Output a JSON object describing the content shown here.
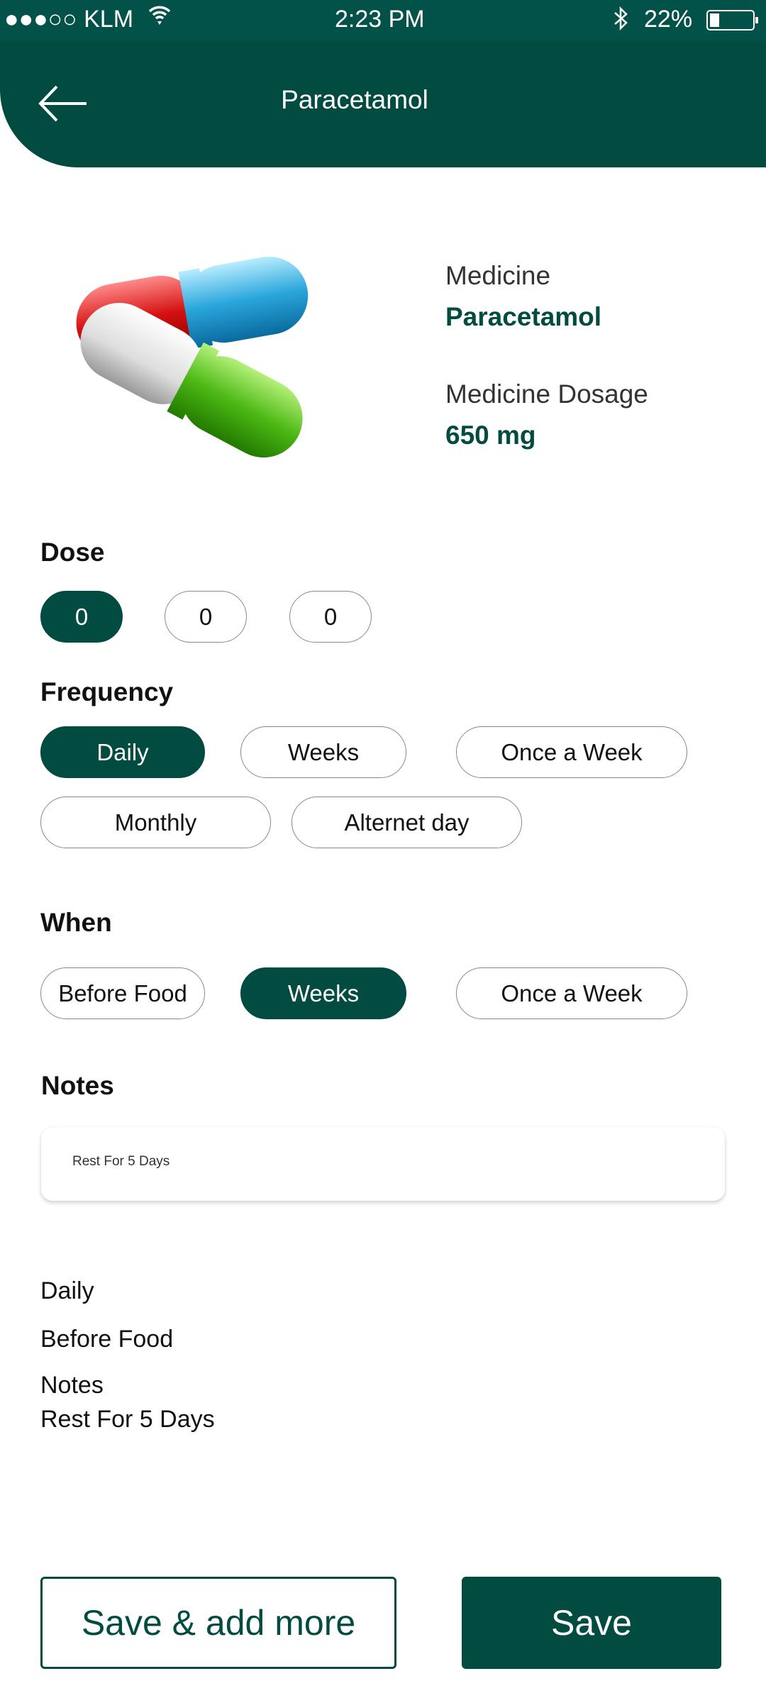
{
  "status": {
    "carrier": "●●●○○ KLM",
    "time": "2:23 PM",
    "battery": "22%",
    "battery_level": 0.22
  },
  "header": {
    "title": "Paracetamol"
  },
  "medicine": {
    "name_label": "Medicine",
    "name": "Paracetamol",
    "dosage_label": "Medicine Dosage",
    "dosage": "650 mg"
  },
  "dose": {
    "heading": "Dose",
    "options": [
      "0",
      "0",
      "0"
    ],
    "selected": 0
  },
  "frequency": {
    "heading": "Frequency",
    "options": [
      "Daily",
      "Weeks",
      "Once a Week",
      "Monthly",
      "Alternet day"
    ],
    "selected": 0
  },
  "when": {
    "heading": "When",
    "options": [
      "Before Food",
      "Weeks",
      "Once a Week"
    ],
    "selected": 1
  },
  "notes": {
    "heading": "Notes",
    "value": "Rest For 5 Days"
  },
  "summary": {
    "frequency": "Daily",
    "when": "Before Food",
    "notes_label": "Notes",
    "notes": "Rest For 5 Days"
  },
  "buttons": {
    "save_add_more": "Save & add more",
    "save": "Save"
  },
  "colors": {
    "primary": "#014b41",
    "status_bar": "#03524a"
  }
}
